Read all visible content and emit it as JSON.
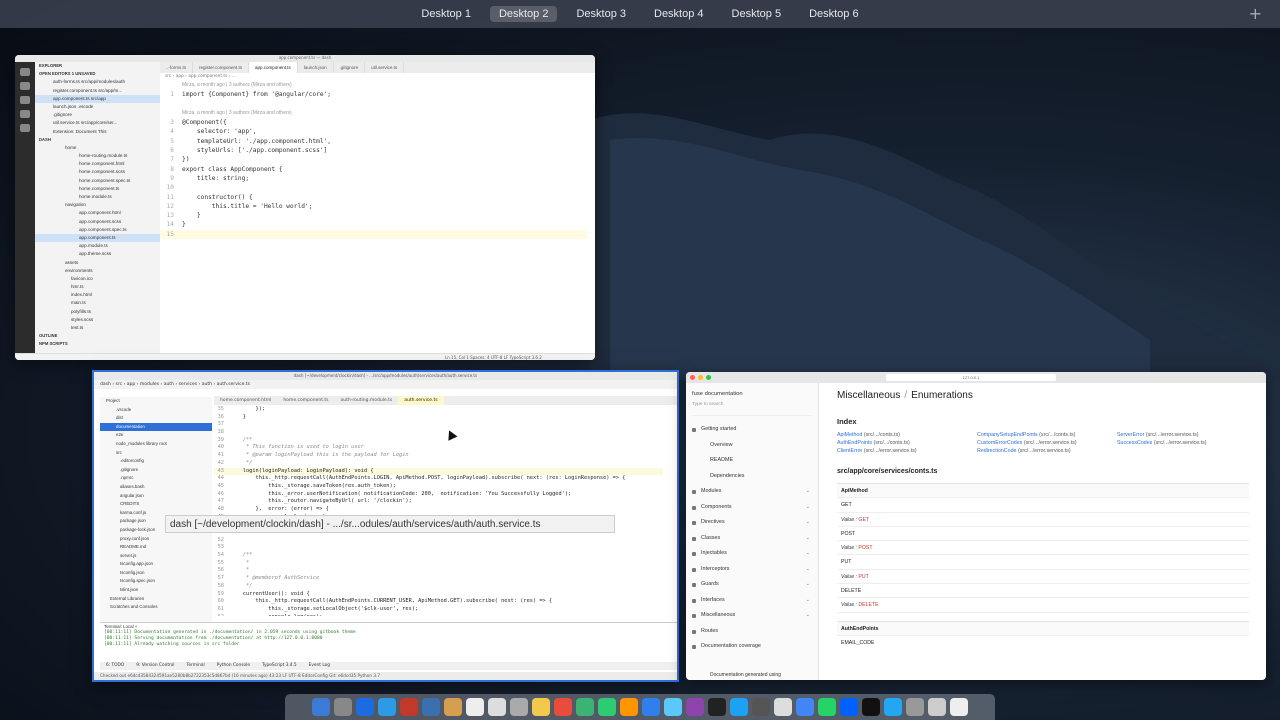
{
  "desktops": [
    "Desktop 1",
    "Desktop 2",
    "Desktop 3",
    "Desktop 4",
    "Desktop 5",
    "Desktop 6"
  ],
  "active_desktop": "Desktop 2",
  "add_desktop": "+",
  "vscode": {
    "title": "app.component.ts — dash",
    "tabs": [
      "..-forms.ts",
      "register.component.ts",
      "app.component.ts",
      "launch.json",
      ".gitignore",
      "util.service.ts"
    ],
    "breadcrumb": "src › app › app.component.ts › ...",
    "sidebar": {
      "explorer": "EXPLORER",
      "open_editors": "OPEN EDITORS   1 UNSAVED",
      "open_files": [
        "auth-forms.ts  src/app/modules/auth",
        "register.component.ts  src/app/m...",
        "app.component.ts  src/app",
        "launch.json  .vscode",
        ".gitignore",
        "util.service.ts  src/app/core/ser...",
        "Extension: Document This"
      ],
      "dash": "DASH",
      "tree": [
        "home",
        "home-routing.module.ts",
        "home.component.html",
        "home.component.scss",
        "home.component.spec.ts",
        "home.component.ts",
        "home.module.ts",
        "navigation",
        "app.component.html",
        "app.component.scss",
        "app.component.spec.ts",
        "app.component.ts",
        "app.module.ts",
        "app.theme.scss",
        "assets",
        "environments",
        "favicon.ico",
        "hmr.ts",
        "index.html",
        "main.ts",
        "polyfills.ts",
        "styles.scss",
        "test.ts"
      ],
      "outline": "OUTLINE",
      "npm": "NPM SCRIPTS"
    },
    "code": [
      {
        "n": "",
        "meta": true,
        "t": "Mirza, a month ago | 3 authors (Mirza and others)"
      },
      {
        "n": "1",
        "t": "import {Component} from '@angular/core';"
      },
      {
        "n": "",
        "meta": true,
        "t": ""
      },
      {
        "n": "",
        "meta": true,
        "t": "Mirza, a month ago | 3 authors (Mirza and others)"
      },
      {
        "n": "3",
        "t": "@Component({"
      },
      {
        "n": "4",
        "t": "    selector: 'app',"
      },
      {
        "n": "5",
        "t": "    templateUrl: './app.component.html',"
      },
      {
        "n": "6",
        "t": "    styleUrls: ['./app.component.scss']"
      },
      {
        "n": "7",
        "t": "})"
      },
      {
        "n": "8",
        "t": "export class AppComponent {"
      },
      {
        "n": "9",
        "t": "    title: string;"
      },
      {
        "n": "10",
        "t": ""
      },
      {
        "n": "11",
        "t": "    constructor() {"
      },
      {
        "n": "12",
        "t": "        this.title = 'Hello world';"
      },
      {
        "n": "13",
        "t": "    }"
      },
      {
        "n": "14",
        "t": "}"
      },
      {
        "n": "15",
        "t": "",
        "cur": true
      }
    ],
    "status": "Ln 15, Col 1   Spaces: 4   UTF-8   LF   TypeScript   3.6.2"
  },
  "idea": {
    "title": "dash [~/development/clockin/dash] - .../src/app/modules/auth/services/auth/auth.service.ts",
    "nav": "dash › src › app › modules › auth › services › auth › auth.service.ts",
    "tabs": [
      "home.component.html",
      "home.component.ts",
      "auth-routing.module.ts",
      "auth.service.ts"
    ],
    "project_title": "Project",
    "tree": [
      ".vscode",
      "dist",
      "documentation",
      "e2e",
      "node_modules  library root",
      "src",
      ".editorconfig",
      ".gitignore",
      ".npmrc",
      "aliases.bash",
      "angular.json",
      "CREDITS",
      "karma.conf.js",
      "package.json",
      "package-lock.json",
      "proxy.conf.json",
      "README.md",
      "server.js",
      "tsconfig.app.json",
      "tsconfig.json",
      "tsconfig.spec.json",
      "tslint.json",
      "External Libraries",
      "Scratches and Consoles"
    ],
    "code": [
      {
        "n": "35",
        "t": "        });"
      },
      {
        "n": "36",
        "t": "    }"
      },
      {
        "n": "37",
        "t": ""
      },
      {
        "n": "38",
        "t": ""
      },
      {
        "n": "39",
        "t": "    /**"
      },
      {
        "n": "40",
        "t": "     * This function is used to login user"
      },
      {
        "n": "41",
        "t": "     * @param loginPayload this is the payload for Login"
      },
      {
        "n": "42",
        "t": "     */"
      },
      {
        "n": "43",
        "t": "    login(loginPayload: LoginPayload): void {",
        "hl": true
      },
      {
        "n": "44",
        "t": "        this._http.requestCall(AuthEndPoints.LOGIN, ApiMethod.POST, loginPayload).subscribe( next: (res: LoginResponse) => {"
      },
      {
        "n": "45",
        "t": "            this._storage.saveToken(res.auth_token);"
      },
      {
        "n": "46",
        "t": "            this._error.userNotification( notificationCode: 200,  notification: 'You Successfully Logged');"
      },
      {
        "n": "47",
        "t": "            this._router.navigateByUrl( url: '/clockin');"
      },
      {
        "n": "48",
        "t": "        },  error: (error) => {"
      },
      {
        "n": "49",
        "t": "            console.log(error);"
      },
      {
        "n": "50",
        "t": ""
      },
      {
        "n": "51",
        "t": ""
      },
      {
        "n": "52",
        "t": ""
      },
      {
        "n": "53",
        "t": ""
      },
      {
        "n": "54",
        "t": "    /**"
      },
      {
        "n": "55",
        "t": "     *"
      },
      {
        "n": "56",
        "t": "     *"
      },
      {
        "n": "57",
        "t": "     * @memberof AuthService"
      },
      {
        "n": "58",
        "t": "     */"
      },
      {
        "n": "59",
        "t": "    currentUser(): void {"
      },
      {
        "n": "60",
        "t": "        this._http.requestCall(AuthEndPoints.CURRENT_USER, ApiMethod.GET).subscribe( next: (res) => {"
      },
      {
        "n": "61",
        "t": "            this._storage.setLocalObject('$clk-user', res);"
      },
      {
        "n": "62",
        "t": "            console.log(res);"
      }
    ],
    "tooltip": "dash [~/development/clockin/dash] - .../sr...odules/auth/services/auth/auth.service.ts",
    "terminal_label": "Terminal:",
    "terminal_tab": "Local",
    "terminal_lines": [
      "[00:11:11] Documentation generated in ./documentation/ in 2.059 seconds using gitbook theme",
      "[00:11:11] Serving documentation from ./documentation/ at http://127.0.0.1:8080",
      "[00:11:11] Already watching sources in src folder"
    ],
    "toolbar": [
      "6: TODO",
      "9: Version Control",
      "Terminal",
      "Python Console",
      "TypeScript 3.4.5",
      "Event Log"
    ],
    "status": "Checked out e6dcd3584324591ae5280b8b2722353c5d867bd (16 minutes ago)          43:23   LF   UTF-8   EditorConfig   Git: e6dcd35   Python 3.7"
  },
  "browser": {
    "url": "127.0.0.1",
    "brand": "fuse documentation",
    "search_placeholder": "Type to search",
    "nav": [
      {
        "label": "Getting started",
        "sub": false,
        "chev": ""
      },
      {
        "label": "Overview",
        "sub": true,
        "chev": ""
      },
      {
        "label": "README",
        "sub": true,
        "chev": ""
      },
      {
        "label": "Dependencies",
        "sub": true,
        "chev": ""
      },
      {
        "label": "Modules",
        "sub": false,
        "chev": "⌄"
      },
      {
        "label": "Components",
        "sub": false,
        "chev": "⌄"
      },
      {
        "label": "Directives",
        "sub": false,
        "chev": "⌄"
      },
      {
        "label": "Classes",
        "sub": false,
        "chev": "⌄"
      },
      {
        "label": "Injectables",
        "sub": false,
        "chev": "⌄"
      },
      {
        "label": "Interceptors",
        "sub": false,
        "chev": "⌄"
      },
      {
        "label": "Guards",
        "sub": false,
        "chev": "⌄"
      },
      {
        "label": "Interfaces",
        "sub": false,
        "chev": "⌄"
      },
      {
        "label": "Miscellaneous",
        "sub": false,
        "chev": "⌄"
      },
      {
        "label": "Routes",
        "sub": false,
        "chev": ""
      },
      {
        "label": "Documentation coverage",
        "sub": false,
        "chev": ""
      }
    ],
    "footer": "Documentation generated using",
    "crumb_parent": "Miscellaneous",
    "crumb_sep": "/",
    "crumb_current": "Enumerations",
    "index_title": "Index",
    "index": [
      {
        "name": "ApiMethod",
        "path": "(src/.../conts.ts)"
      },
      {
        "name": "CompanySetupEndPoints",
        "path": "(src/.../conts.ts)"
      },
      {
        "name": "ServerError",
        "path": "(src/.../error.service.ts)"
      },
      {
        "name": "AuthEndPoints",
        "path": "(src/.../conts.ts)"
      },
      {
        "name": "CustomErrorCodes",
        "path": "(src/.../error.service.ts)"
      },
      {
        "name": "SuccessCodes",
        "path": "(src/.../error.service.ts)"
      },
      {
        "name": "ClientError",
        "path": "(src/.../error.service.ts)"
      },
      {
        "name": "RedirectionCode",
        "path": "(src/.../error.service.ts)"
      },
      {
        "name": "",
        "path": ""
      }
    ],
    "section_title": "src/app/core/services/conts.ts",
    "enum1_name": "ApiMethod",
    "enum1_rows": [
      {
        "k": "GET",
        "v": false
      },
      {
        "k": "GET",
        "v": true
      },
      {
        "k": "POST",
        "v": false
      },
      {
        "k": "POST",
        "v": true
      },
      {
        "k": "PUT",
        "v": false
      },
      {
        "k": "PUT",
        "v": true
      },
      {
        "k": "DELETE",
        "v": false
      },
      {
        "k": "DELETE",
        "v": true
      }
    ],
    "value_label": "Value :",
    "enum2_name": "AuthEndPoints",
    "enum2_first": "EMAIL_CODE"
  },
  "colors": {
    "accent": "#2f6fd8",
    "danger": "#c0392b",
    "vscode_activity": "#2c2c2c"
  }
}
